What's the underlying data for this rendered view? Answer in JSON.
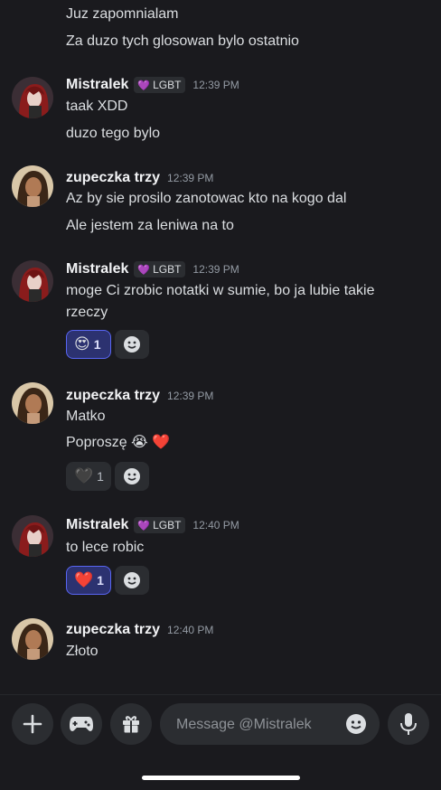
{
  "messages": [
    {
      "lines": [
        "Juz zapomnialam",
        "Za duzo tych glosowan bylo ostatnio"
      ]
    },
    {
      "author": "Mistralek",
      "tag": "LGBT",
      "time": "12:39 PM",
      "lines": [
        "taak XDD",
        "duzo tego bylo"
      ]
    },
    {
      "author": "zupeczka trzy",
      "time": "12:39 PM",
      "lines": [
        "Az by sie prosilo zanotowac kto na kogo dal",
        "Ale jestem za leniwa na to"
      ]
    },
    {
      "author": "Mistralek",
      "tag": "LGBT",
      "time": "12:39 PM",
      "lines": [
        "moge Ci zrobic notatki w sumie, bo ja lubie takie",
        "rzeczy"
      ],
      "reactions": [
        {
          "emoji": "😍",
          "count": "1"
        }
      ]
    },
    {
      "author": "zupeczka trzy",
      "time": "12:39 PM",
      "lines": [
        "Matko",
        "Poproszę 😭 ❤️"
      ],
      "reactions": [
        {
          "emoji": "🖤",
          "count": "1"
        }
      ]
    },
    {
      "author": "Mistralek",
      "tag": "LGBT",
      "time": "12:40 PM",
      "lines": [
        "to lece robic"
      ],
      "reactions": [
        {
          "emoji": "❤️",
          "count": "1"
        }
      ]
    },
    {
      "author": "zupeczka trzy",
      "time": "12:40 PM",
      "lines": [
        "Złoto"
      ]
    }
  ],
  "composer": {
    "placeholder": "Message @Mistralek"
  },
  "icons": [
    "plus-icon",
    "gamepad-icon",
    "gift-icon",
    "emoji-icon",
    "microphone-icon",
    "add-reaction-icon"
  ]
}
